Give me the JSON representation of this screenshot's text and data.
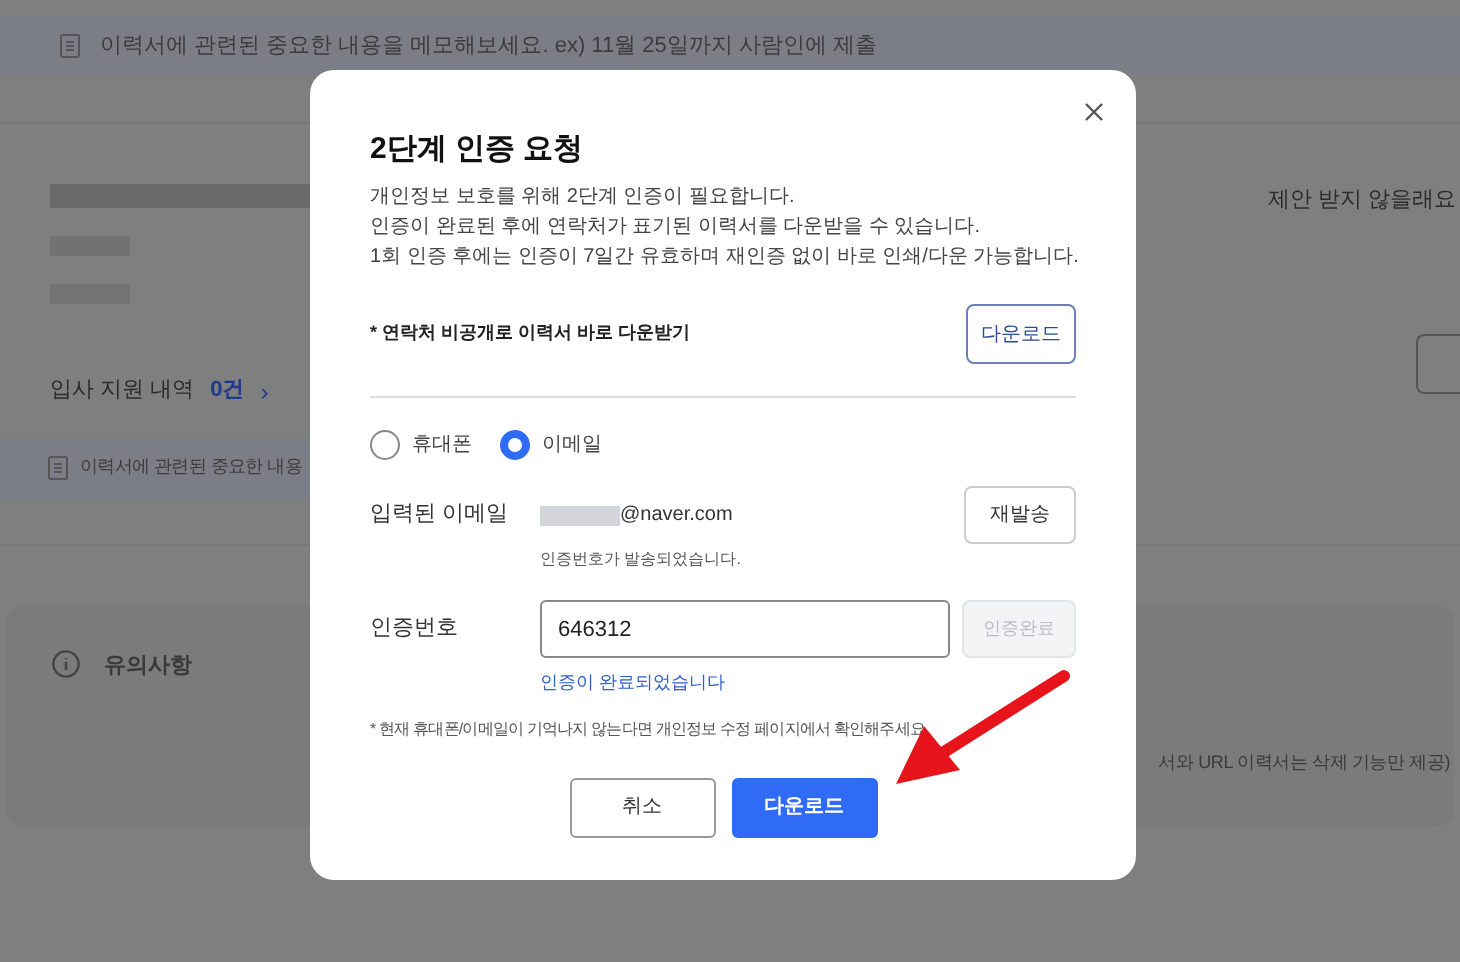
{
  "background": {
    "memo_top": "이력서에 관련된 중요한 내용을 메모해보세요. ex) 11월 25일까지 사람인에 제출",
    "offer_link": "제안 받지 않을래요",
    "applications": {
      "label": "입사 지원 내역",
      "count": "0건",
      "chevron": "›"
    },
    "memo_second": "이력서에 관련된 중요한 내용",
    "notice": {
      "title": "유의사항",
      "text": "서와 URL 이력서는 삭제 기능만 제공)"
    }
  },
  "modal": {
    "title": "2단계 인증 요청",
    "description": [
      "개인정보 보호를 위해 2단계 인증이 필요합니다.",
      "인증이 완료된 후에 연락처가 표기된 이력서를 다운받을 수 있습니다.",
      "1회 인증 후에는 인증이 7일간 유효하며 재인증 없이 바로 인쇄/다운 가능합니다."
    ],
    "quick_download": {
      "label": "* 연락처 비공개로 이력서 바로 다운받기",
      "button": "다운로드"
    },
    "methods": [
      {
        "label": "휴대폰",
        "selected": false
      },
      {
        "label": "이메일",
        "selected": true
      }
    ],
    "email": {
      "label": "입력된 이메일",
      "value": "@naver.com",
      "resend": "재발송",
      "sent_message": "인증번호가 발송되었습니다."
    },
    "code": {
      "label": "인증번호",
      "value": "646312",
      "confirm": {
        "label": "인증완료",
        "disabled": true
      },
      "success": "인증이 완료되었습니다"
    },
    "footnote": "* 현재 휴대폰/이메일이 기억나지 않는다면 개인정보 수정 페이지에서 확인해주세요",
    "buttons": [
      {
        "label": "취소",
        "kind": "secondary"
      },
      {
        "label": "다운로드",
        "kind": "primary"
      }
    ]
  }
}
